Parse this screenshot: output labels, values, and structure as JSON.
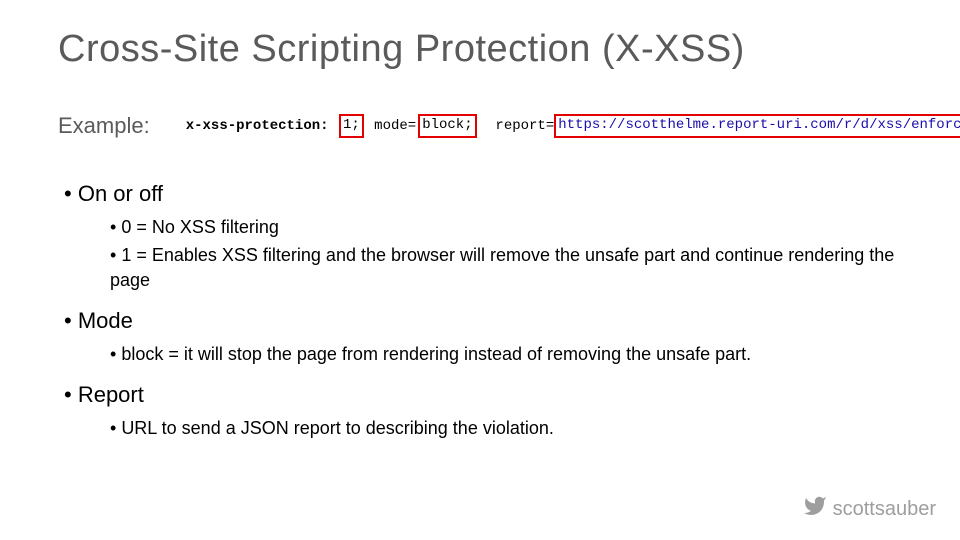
{
  "title": "Cross-Site Scripting Protection (X-XSS)",
  "example": {
    "label": "Example:",
    "code": {
      "key": "x-xss-protection:",
      "val1": "1;",
      "mode_pre": "mode=",
      "mode_val": "block;",
      "report_pre": "report=",
      "report_url": "https://scotthelme.report-uri.com/r/d/xss/enforce"
    }
  },
  "bullets": {
    "onoff": {
      "label": "On or off",
      "subs": [
        "0 = No XSS filtering",
        "1 = Enables XSS filtering and the browser will remove the unsafe part and continue rendering the page"
      ]
    },
    "mode": {
      "label": "Mode",
      "subs": [
        "block = it will stop the page from rendering instead of removing the unsafe part."
      ]
    },
    "report": {
      "label": "Report",
      "subs": [
        "URL to send a JSON report to describing the violation."
      ]
    }
  },
  "footer": {
    "handle": "scottsauber"
  }
}
